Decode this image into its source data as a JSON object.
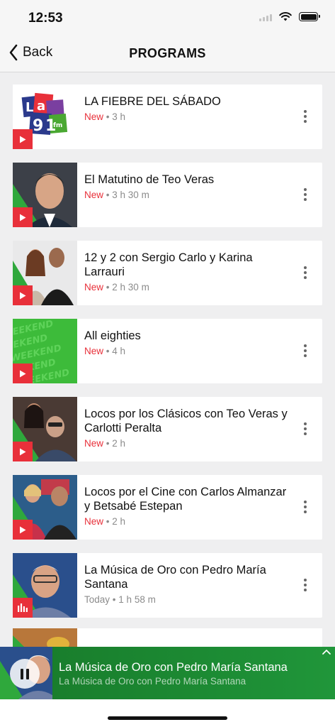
{
  "status_bar": {
    "time": "12:53"
  },
  "nav": {
    "back_label": "Back",
    "title": "PROGRAMS"
  },
  "programs": [
    {
      "title": "LA FIEBRE DEL SÁBADO",
      "status": "New",
      "separator": "•",
      "duration": "3 h",
      "thumb": "la91-logo",
      "badge_icon": "play-icon"
    },
    {
      "title": "El Matutino de Teo Veras",
      "status": "New",
      "separator": "•",
      "duration": "3 h 30 m",
      "thumb": "host-photo",
      "badge_icon": "play-icon"
    },
    {
      "title": "12 y 2 con Sergio Carlo y Karina Larrauri",
      "status": "New",
      "separator": "•",
      "duration": "2 h 30 m",
      "thumb": "hosts-photo",
      "badge_icon": "play-icon"
    },
    {
      "title": "All eighties",
      "status": "New",
      "separator": "•",
      "duration": "4 h",
      "thumb": "weekend-pattern",
      "badge_icon": "play-icon"
    },
    {
      "title": "Locos por los Clásicos con Teo Veras y Carlotti Peralta",
      "status": "New",
      "separator": "•",
      "duration": "2 h",
      "thumb": "hosts-photo",
      "badge_icon": "play-icon"
    },
    {
      "title": "Locos por el Cine con Carlos Almanzar y Betsabé Estepan",
      "status": "New",
      "separator": "•",
      "duration": "2 h",
      "thumb": "hosts-photo",
      "badge_icon": "play-icon"
    },
    {
      "title": "La Música de Oro con Pedro María Santana",
      "status": "Today",
      "separator": "•",
      "duration": "1 h 58 m",
      "thumb": "host-photo",
      "badge_icon": "equalizer-icon"
    }
  ],
  "player": {
    "title": "La Música de Oro con Pedro María Santana",
    "subtitle": "La Música de Oro con Pedro María Santana",
    "state": "playing"
  },
  "colors": {
    "accent_red": "#e8303a",
    "player_green": "#1c8a33",
    "background": "#efeff0"
  }
}
